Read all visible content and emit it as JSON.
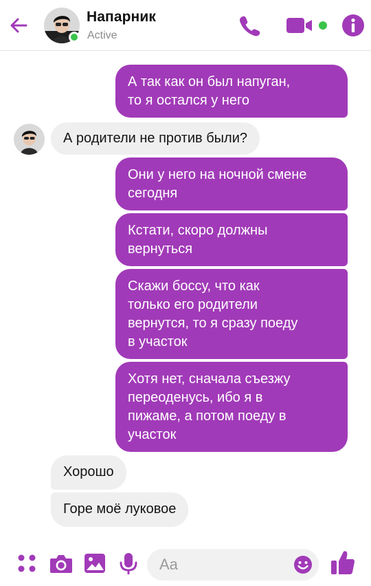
{
  "header": {
    "contact_name": "Напарник",
    "status": "Active"
  },
  "colors": {
    "accent": "#a13ab8",
    "online": "#3ac34b",
    "incoming_bubble": "#efefef"
  },
  "icons": [
    "back-arrow-icon",
    "phone-icon",
    "video-camera-icon",
    "info-icon",
    "apps-grid-icon",
    "camera-icon",
    "gallery-icon",
    "microphone-icon",
    "emoji-icon",
    "thumbs-up-icon"
  ],
  "messages": [
    {
      "direction": "outgoing",
      "text": "А так как он был напуган,\nто я остался у него"
    },
    {
      "direction": "incoming",
      "text": "А родители не против были?"
    },
    {
      "direction": "outgoing",
      "text": "Они у него на ночной смене\nсегодня"
    },
    {
      "direction": "outgoing",
      "text": "Кстати, скоро должны\nвернуться"
    },
    {
      "direction": "outgoing",
      "text": "Скажи боссу, что как\nтолько его родители\nвернутся, то я сразу поеду\nв участок"
    },
    {
      "direction": "outgoing",
      "text": "Хотя нет, сначала съезжу\nпереоденусь, ибо я в\nпижаме, а потом поеду в\nучасток"
    },
    {
      "direction": "incoming",
      "text": "Хорошо"
    },
    {
      "direction": "incoming",
      "text": "Горе моё луковое"
    }
  ],
  "composer": {
    "placeholder": "Aa"
  }
}
